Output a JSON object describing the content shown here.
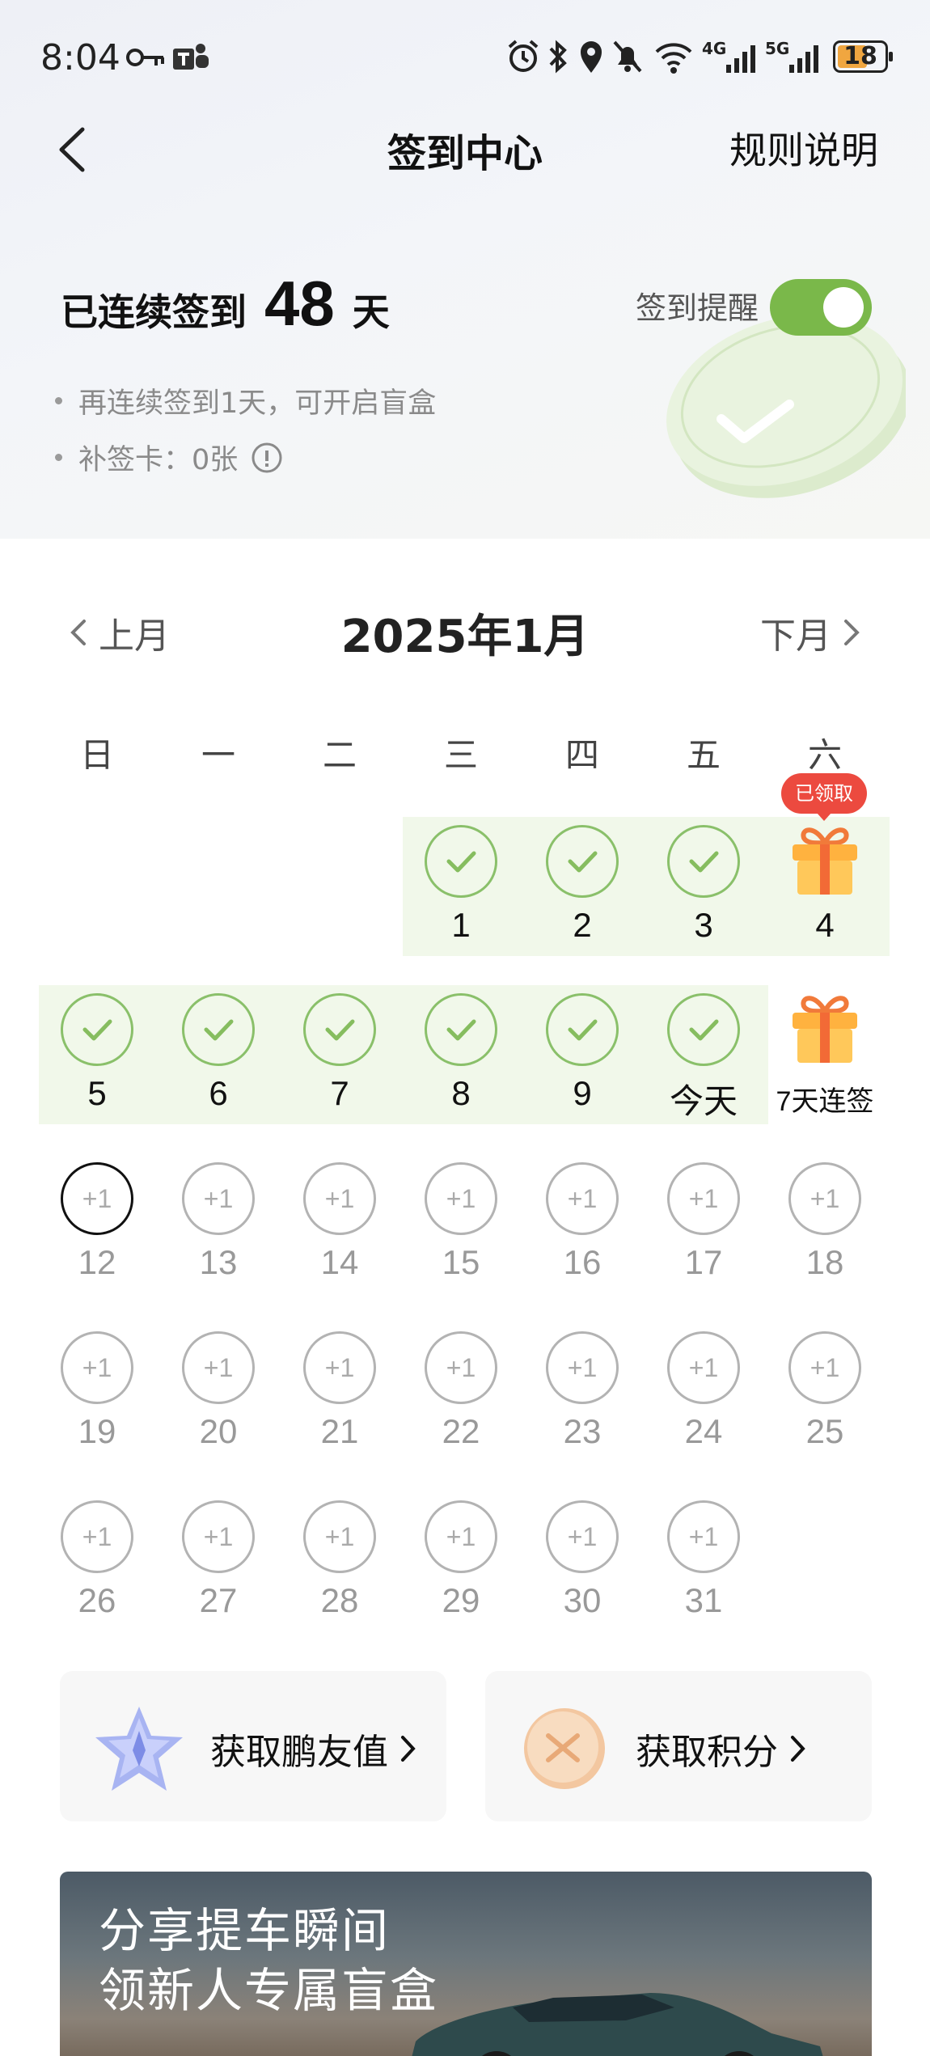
{
  "status_bar": {
    "time": "8:04",
    "battery": "18",
    "net1": "4G",
    "net2": "5G"
  },
  "nav": {
    "title": "签到中心",
    "rules_label": "规则说明"
  },
  "streak": {
    "prefix": "已连续签到",
    "days": "48",
    "suffix": "天",
    "reminder_label": "签到提醒",
    "reminder_on": true
  },
  "notes": [
    "再连续签到1天，可开启盲盒",
    "补签卡：0张"
  ],
  "calendar": {
    "prev_label": "上月",
    "next_label": "下月",
    "title": "2025年1月",
    "weekdays": [
      "日",
      "一",
      "二",
      "三",
      "四",
      "五",
      "六"
    ],
    "claimed_badge": "已领取",
    "plus_label": "+1",
    "rows": [
      [
        null,
        null,
        null,
        {
          "label": "1",
          "state": "done"
        },
        {
          "label": "2",
          "state": "done"
        },
        {
          "label": "3",
          "state": "done"
        },
        {
          "label": "4",
          "state": "gift",
          "badge": true
        }
      ],
      [
        {
          "label": "5",
          "state": "done"
        },
        {
          "label": "6",
          "state": "done"
        },
        {
          "label": "7",
          "state": "done"
        },
        {
          "label": "8",
          "state": "done"
        },
        {
          "label": "9",
          "state": "done"
        },
        {
          "label": "今天",
          "state": "done"
        },
        {
          "label": "7天连签",
          "state": "gift"
        }
      ],
      [
        {
          "label": "12",
          "state": "future",
          "ring": true
        },
        {
          "label": "13",
          "state": "future"
        },
        {
          "label": "14",
          "state": "future"
        },
        {
          "label": "15",
          "state": "future"
        },
        {
          "label": "16",
          "state": "future"
        },
        {
          "label": "17",
          "state": "future"
        },
        {
          "label": "18",
          "state": "future"
        }
      ],
      [
        {
          "label": "19",
          "state": "future"
        },
        {
          "label": "20",
          "state": "future"
        },
        {
          "label": "21",
          "state": "future"
        },
        {
          "label": "22",
          "state": "future"
        },
        {
          "label": "23",
          "state": "future"
        },
        {
          "label": "24",
          "state": "future"
        },
        {
          "label": "25",
          "state": "future"
        }
      ],
      [
        {
          "label": "26",
          "state": "future"
        },
        {
          "label": "27",
          "state": "future"
        },
        {
          "label": "28",
          "state": "future"
        },
        {
          "label": "29",
          "state": "future"
        },
        {
          "label": "30",
          "state": "future"
        },
        {
          "label": "31",
          "state": "future"
        },
        null
      ]
    ]
  },
  "cards": [
    {
      "label": "获取鹏友值",
      "icon": "star-icon"
    },
    {
      "label": "获取积分",
      "icon": "coin-icon"
    }
  ],
  "banner": {
    "line1": "分享提车瞬间",
    "line2": "领新人专属盲盒"
  },
  "colors": {
    "accent_green": "#7ab84a",
    "badge_red": "#ec4a3f",
    "band_green": "#f1f8ea"
  }
}
